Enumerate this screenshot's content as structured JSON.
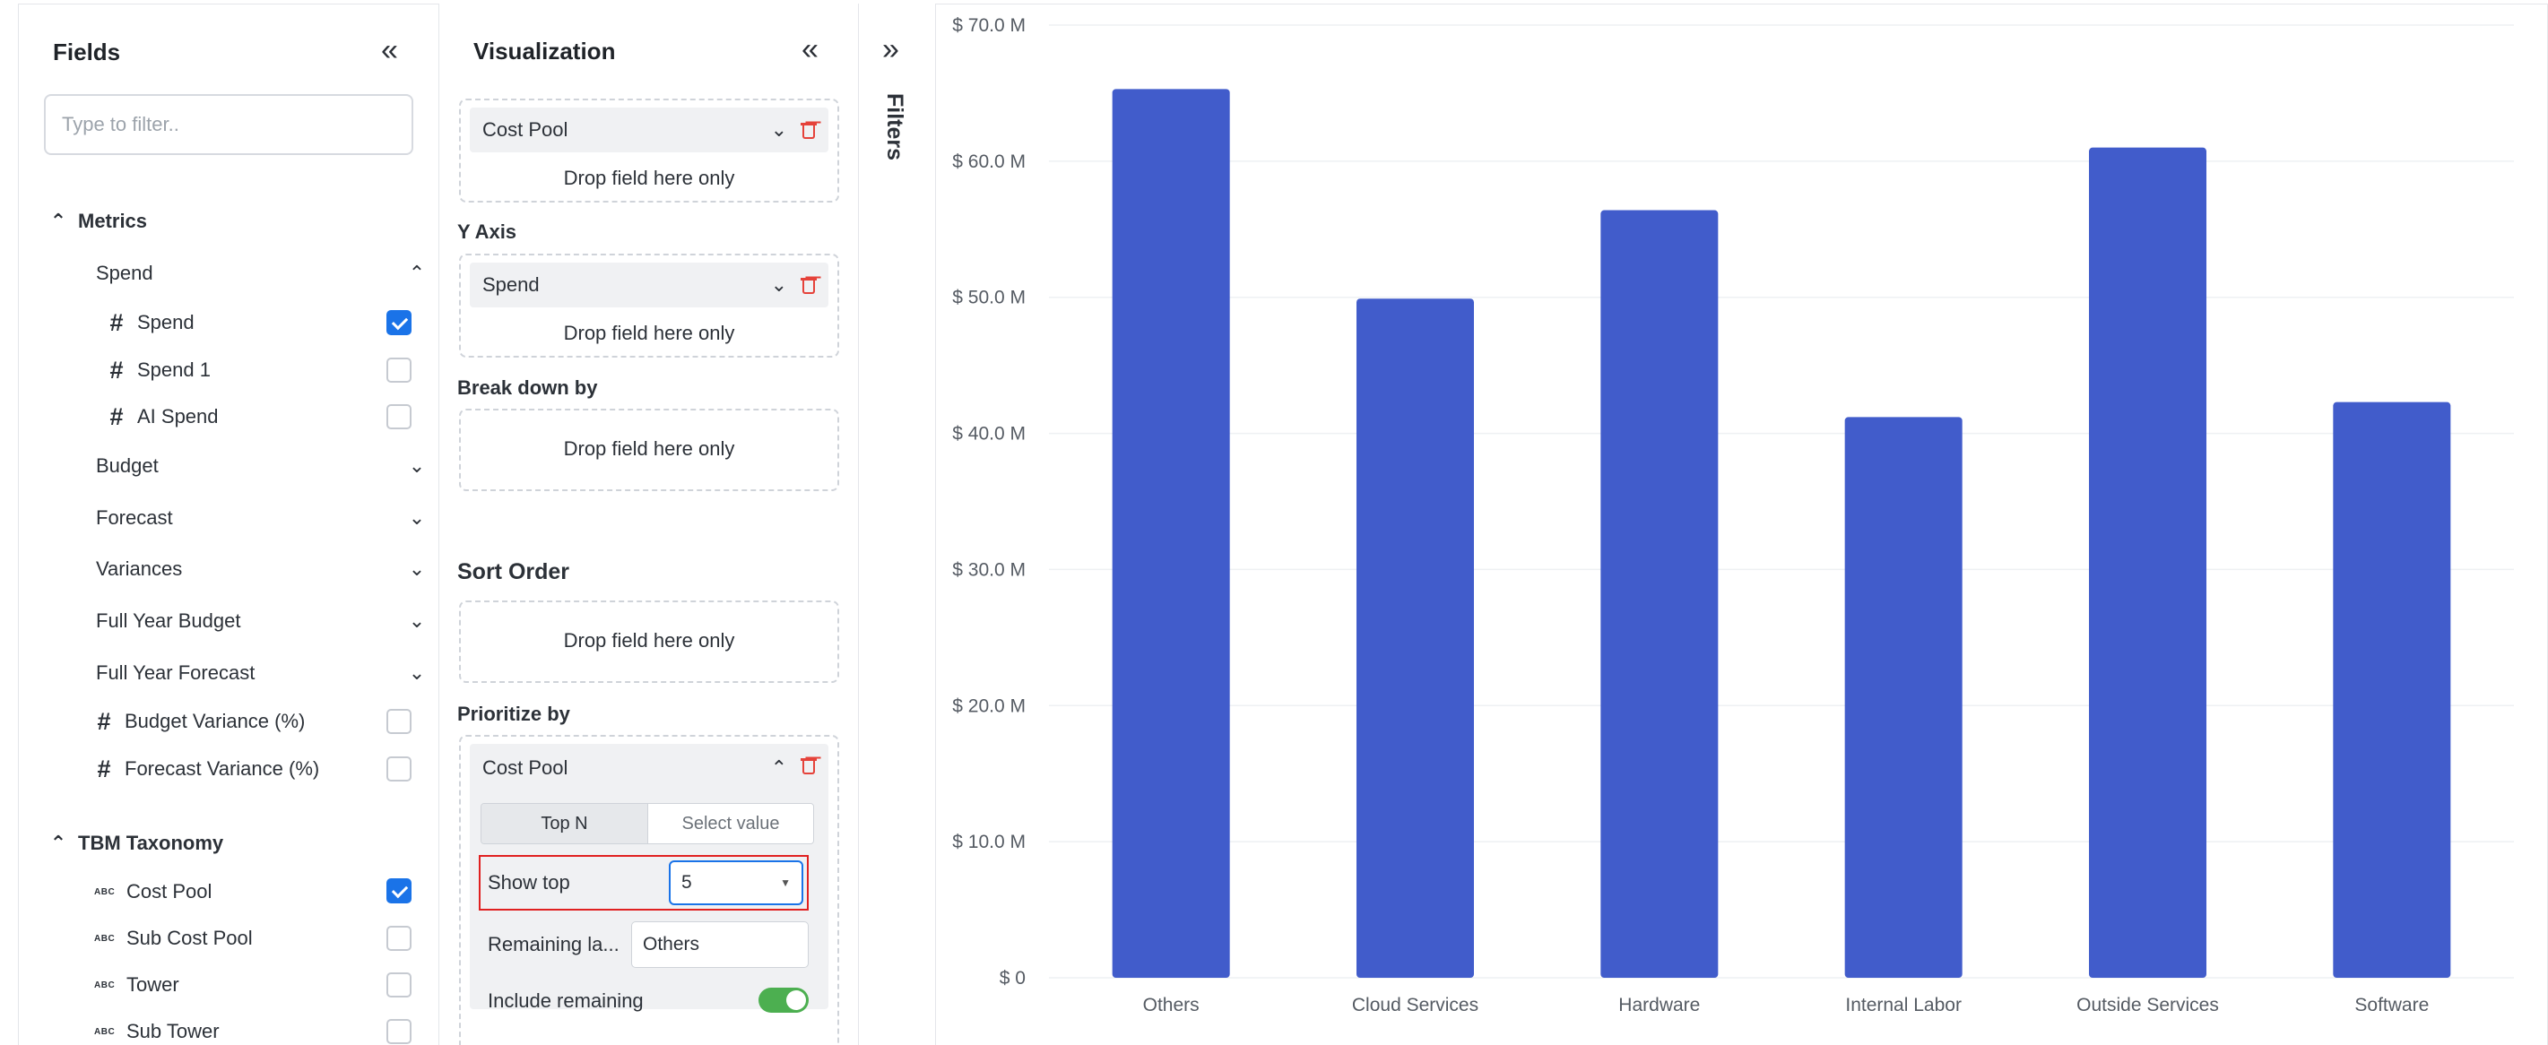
{
  "fields_panel": {
    "title": "Fields",
    "collapse_icon": "double-chevron-left-icon",
    "filter_placeholder": "Type to filter..",
    "metrics_label": "Metrics",
    "spend_group": "Spend",
    "spend_items": [
      {
        "label": "Spend",
        "checked": true
      },
      {
        "label": "Spend 1",
        "checked": false
      },
      {
        "label": "AI Spend",
        "checked": false
      }
    ],
    "collapsed_groups": [
      "Budget",
      "Forecast",
      "Variances",
      "Full Year Budget",
      "Full Year Forecast"
    ],
    "variance_items": [
      {
        "label": "Budget Variance (%)",
        "checked": false
      },
      {
        "label": "Forecast Variance (%)",
        "checked": false
      }
    ],
    "taxonomy_label": "TBM Taxonomy",
    "taxonomy_items": [
      {
        "label": "Cost Pool",
        "checked": true
      },
      {
        "label": "Sub Cost Pool",
        "checked": false
      },
      {
        "label": "Tower",
        "checked": false
      },
      {
        "label": "Sub Tower",
        "checked": false
      }
    ],
    "text_type_icon": "ABC"
  },
  "viz_panel": {
    "title": "Visualization",
    "x_axis_field": "Cost Pool",
    "drop_hint": "Drop field here only",
    "y_axis_label": "Y Axis",
    "y_axis_field": "Spend",
    "breakdown_label": "Break down by",
    "sort_label": "Sort Order",
    "prioritize_label": "Prioritize by",
    "prioritize_field": "Cost Pool",
    "tabs": [
      "Top N",
      "Select value"
    ],
    "active_tab": "Top N",
    "show_top_label": "Show top",
    "show_top_value": "5",
    "remaining_label": "Remaining la...",
    "remaining_value": "Others",
    "include_remaining_label": "Include remaining",
    "include_remaining_on": true
  },
  "filters_label": "Filters",
  "colors": {
    "bar": "#415ccb",
    "accent": "#1a73e8",
    "highlight": "#e02020",
    "toggle": "#4caf50",
    "delete": "#e5423a"
  },
  "chart_data": {
    "type": "bar",
    "categories": [
      "Others",
      "Cloud Services",
      "Hardware",
      "Internal Labor",
      "Outside Services",
      "Software"
    ],
    "series": [
      {
        "values": [
          65.3,
          49.9,
          56.4,
          41.2,
          61.0,
          42.3
        ]
      }
    ],
    "y_ticks": [
      "$ 0",
      "$ 10.0 M",
      "$ 20.0 M",
      "$ 30.0 M",
      "$ 40.0 M",
      "$ 50.0 M",
      "$ 60.0 M",
      "$ 70.0 M"
    ],
    "ylim": [
      0,
      70
    ],
    "grid": true
  }
}
